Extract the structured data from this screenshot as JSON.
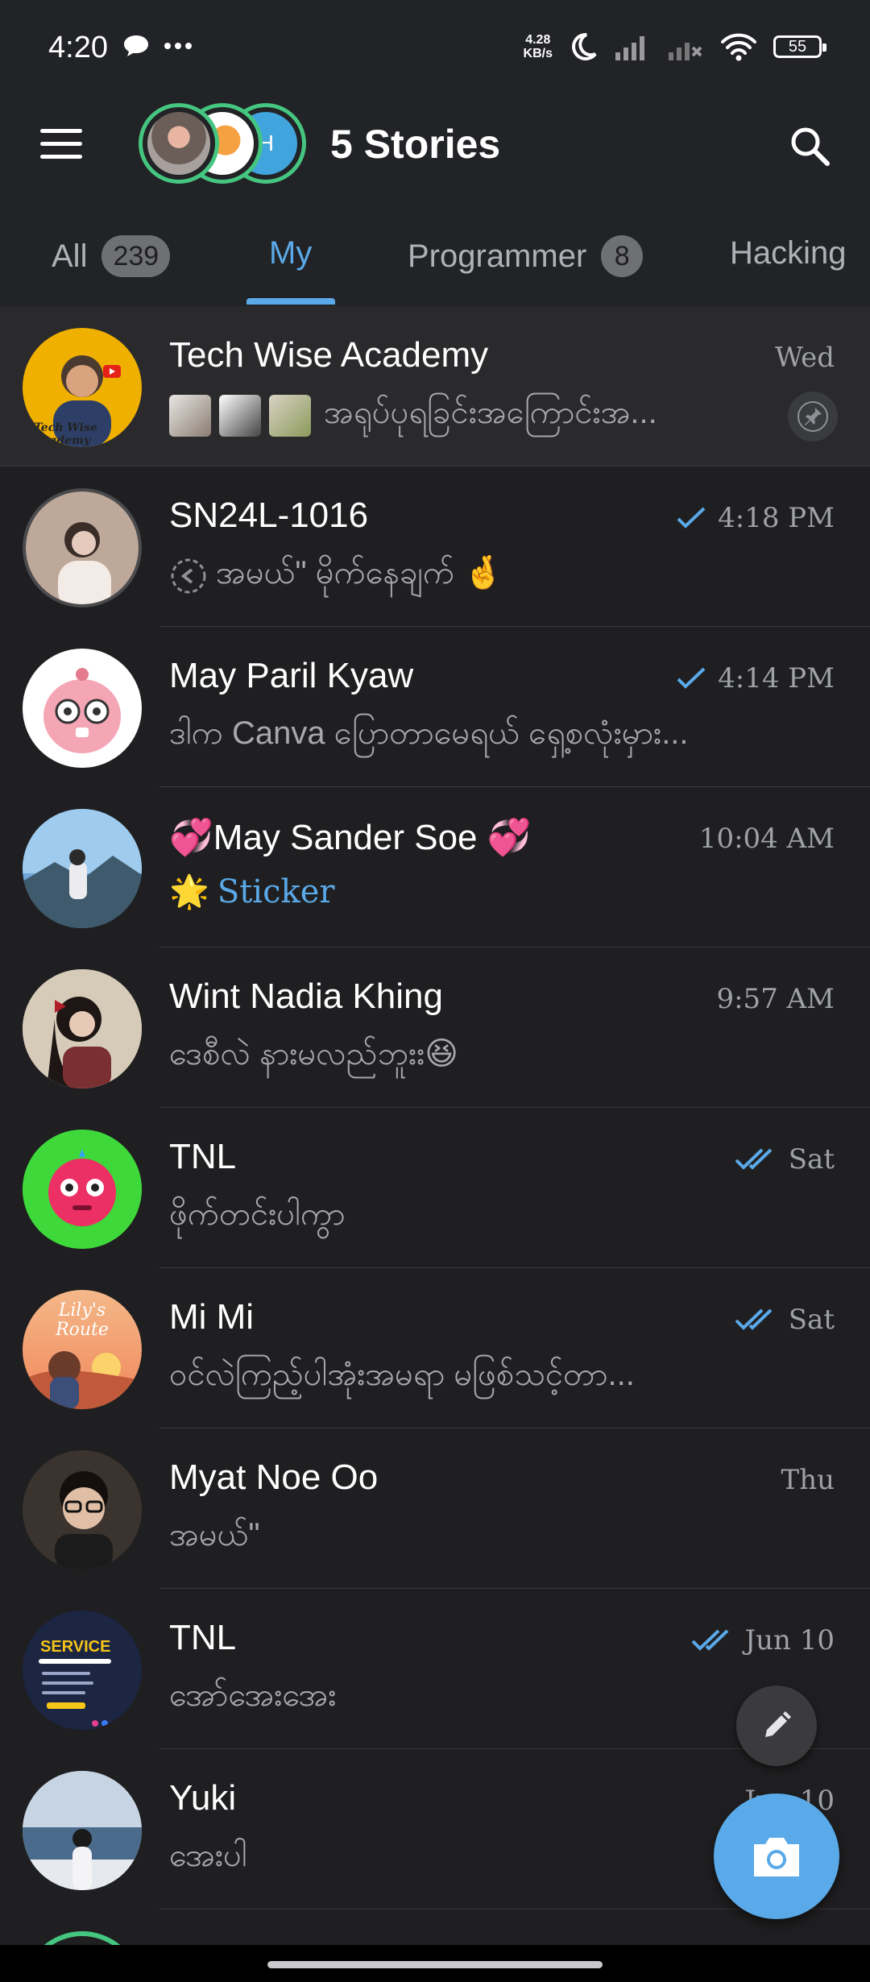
{
  "status_bar": {
    "time": "4:20",
    "net_speed_value": "4.28",
    "net_speed_unit": "KB/s",
    "battery": "55"
  },
  "header": {
    "title": "5 Stories",
    "story_avatar_3_letter": "H"
  },
  "tabs": [
    {
      "label": "All",
      "badge": "239"
    },
    {
      "label": "My"
    },
    {
      "label": "Programmer",
      "badge": "8"
    },
    {
      "label": "Hacking"
    }
  ],
  "chats": [
    {
      "name": "Tech Wise Academy",
      "preview": "အရုပ်ပုရခြင်းအကြောင်းအ...",
      "time": "Wed",
      "pinned": true,
      "avatar_label": "Tech Wise Academy"
    },
    {
      "name": "SN24L-1016",
      "preview": "အမယ်\" မိုက်နေချက် 🤞",
      "time": "4:18 PM",
      "status": "read-single"
    },
    {
      "name": "May Paril Kyaw",
      "preview": "ဒါက Canva ပြောတာမေရယ် ရှေ့စလုံးမှား...",
      "time": "4:14 PM",
      "status": "read-single"
    },
    {
      "name": "💞May Sander Soe 💞",
      "preview": "Sticker",
      "preview_emoji": "🌟",
      "time": "10:04 AM"
    },
    {
      "name": "Wint Nadia Khing",
      "preview": "ဒေစီလဲ နားမလည်ဘူးး😆",
      "time": "9:57 AM"
    },
    {
      "name": "TNL",
      "preview": "ဖိုက်တင်းပါကွာ",
      "time": "Sat",
      "status": "read-double"
    },
    {
      "name": "Mi Mi",
      "preview": "ဝင်လဲကြည့်ပါအုံးအမရာ မဖြစ်သင့်တာ...",
      "time": "Sat",
      "status": "read-double",
      "avatar_label": "Lily's Route"
    },
    {
      "name": "Myat Noe Oo",
      "preview": "အမယ်\"",
      "time": "Thu"
    },
    {
      "name": "TNL",
      "preview": "အော်အေးအေး",
      "time": "Jun 10",
      "status": "read-double",
      "avatar_label": "SERVICE"
    },
    {
      "name": "Yuki",
      "preview": "အေးပါ",
      "time": "Jun 10"
    }
  ],
  "colors": {
    "accent": "#5aa9e8",
    "background": "#1f1f21",
    "header": "#222326",
    "story_ring": "#45c680"
  }
}
